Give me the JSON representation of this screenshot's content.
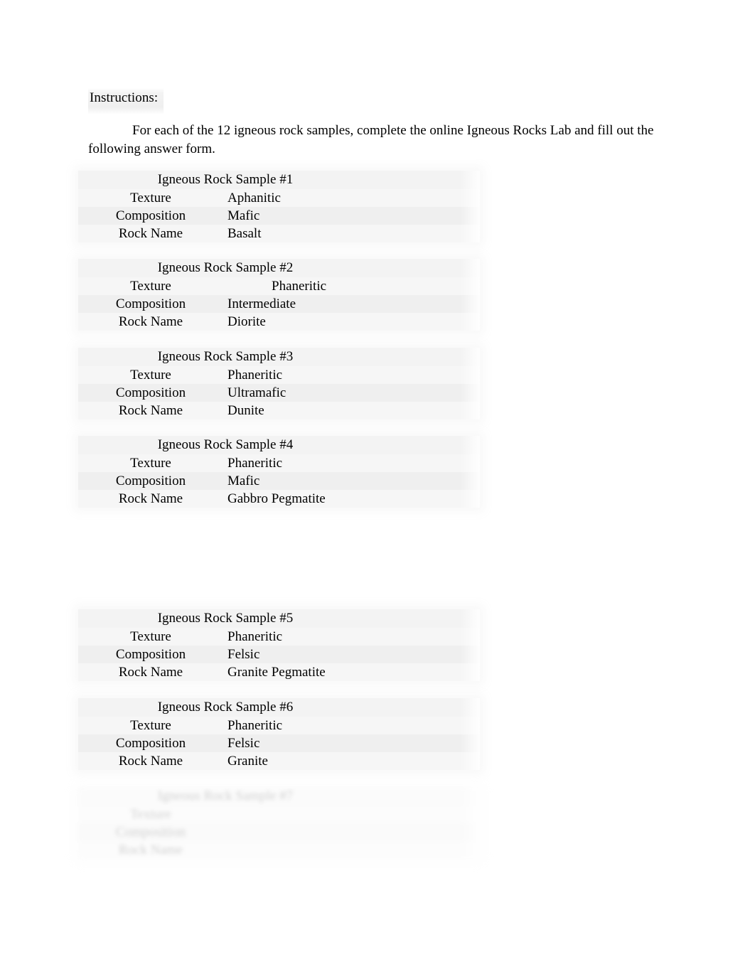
{
  "document": {
    "instructions_heading": "Instructions:",
    "instructions_paragraph": "For each of the 12 igneous rock samples, complete the online Igneous Rocks Lab and fill out the following answer form.",
    "row_labels": {
      "texture": "Texture",
      "composition": "Composition",
      "rock_name": "Rock Name"
    }
  },
  "samples": [
    {
      "title": "Igneous Rock Sample #1",
      "texture_label": "Texture",
      "texture": "Aphanitic",
      "composition_label": "Composition",
      "composition": "Mafic",
      "rock_name_label": "Rock Name",
      "rock_name": "Basalt"
    },
    {
      "title": "Igneous Rock Sample #2",
      "texture_label": "Texture",
      "texture": "Phaneritic",
      "composition_label": "Composition",
      "composition": "Intermediate",
      "rock_name_label": "Rock Name",
      "rock_name": "Diorite"
    },
    {
      "title": "Igneous Rock Sample #3",
      "texture_label": "Texture",
      "texture": "Phaneritic",
      "composition_label": "Composition",
      "composition": "Ultramafic",
      "rock_name_label": "Rock Name",
      "rock_name": "Dunite"
    },
    {
      "title": "Igneous Rock Sample #4",
      "texture_label": "Texture",
      "texture": "Phaneritic",
      "composition_label": "Composition",
      "composition": "Mafic",
      "rock_name_label": "Rock Name",
      "rock_name": "Gabbro Pegmatite"
    },
    {
      "title": "Igneous Rock Sample #5",
      "texture_label": "Texture",
      "texture": "Phaneritic",
      "composition_label": "Composition",
      "composition": "Felsic",
      "rock_name_label": "Rock Name",
      "rock_name": "Granite Pegmatite"
    },
    {
      "title": "Igneous Rock Sample #6",
      "texture_label": "Texture",
      "texture": "Phaneritic",
      "composition_label": "Composition",
      "composition": "Felsic",
      "rock_name_label": "Rock Name",
      "rock_name": "Granite"
    },
    {
      "title": "Igneous Rock Sample #7",
      "texture_label": "Texture",
      "texture": "",
      "composition_label": "Composition",
      "composition": "",
      "rock_name_label": "Rock Name",
      "rock_name": ""
    }
  ]
}
